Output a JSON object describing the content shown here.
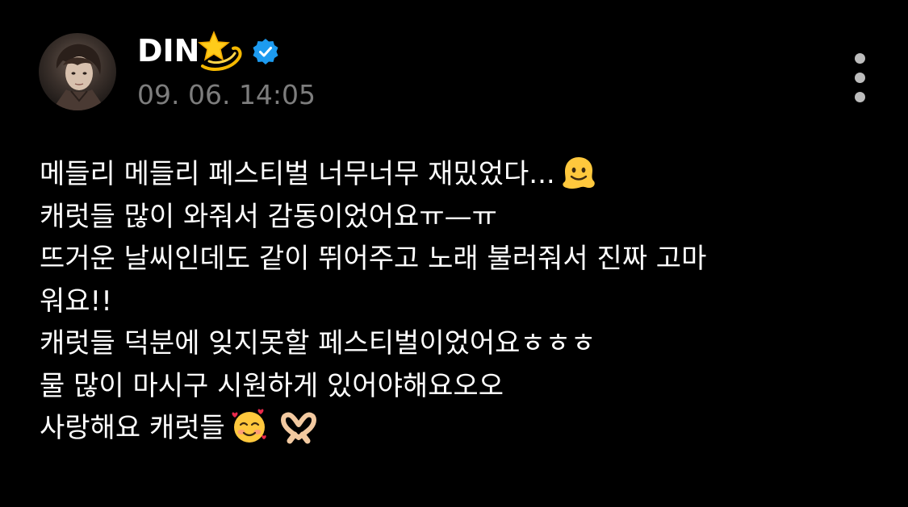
{
  "post": {
    "author": {
      "name": "DIN",
      "name_emoji": "dizzy-star-emoji",
      "verified_icon": "verified-badge-icon",
      "verified_color": "#1d9bf0"
    },
    "timestamp": "09. 06. 14:05",
    "more_icon": "more-vertical-icon",
    "lines": [
      "메들리 메들리 페스티벌 너무너무 재밌었다...",
      "캐럿들 많이 와줘서 감동이었어요ㅠ—ㅠ",
      "뜨거운 날씨인데도 같이 뛰어주고 노래 불러줘서 진짜 고마",
      "워요!!",
      "캐럿들 덕분에 잊지못할 페스티벌이었어요ㅎㅎㅎ",
      "물 많이 마시구 시원하게 있어야해요오오",
      "사랑해요 캐럿들"
    ],
    "emojis": {
      "line1": "melting-face-emoji",
      "line7a": "smiling-face-with-hearts-emoji",
      "line7b": "heart-hands-emoji"
    }
  },
  "colors": {
    "background": "#000000",
    "text": "#ffffff",
    "timestamp": "#7d7d7d"
  }
}
